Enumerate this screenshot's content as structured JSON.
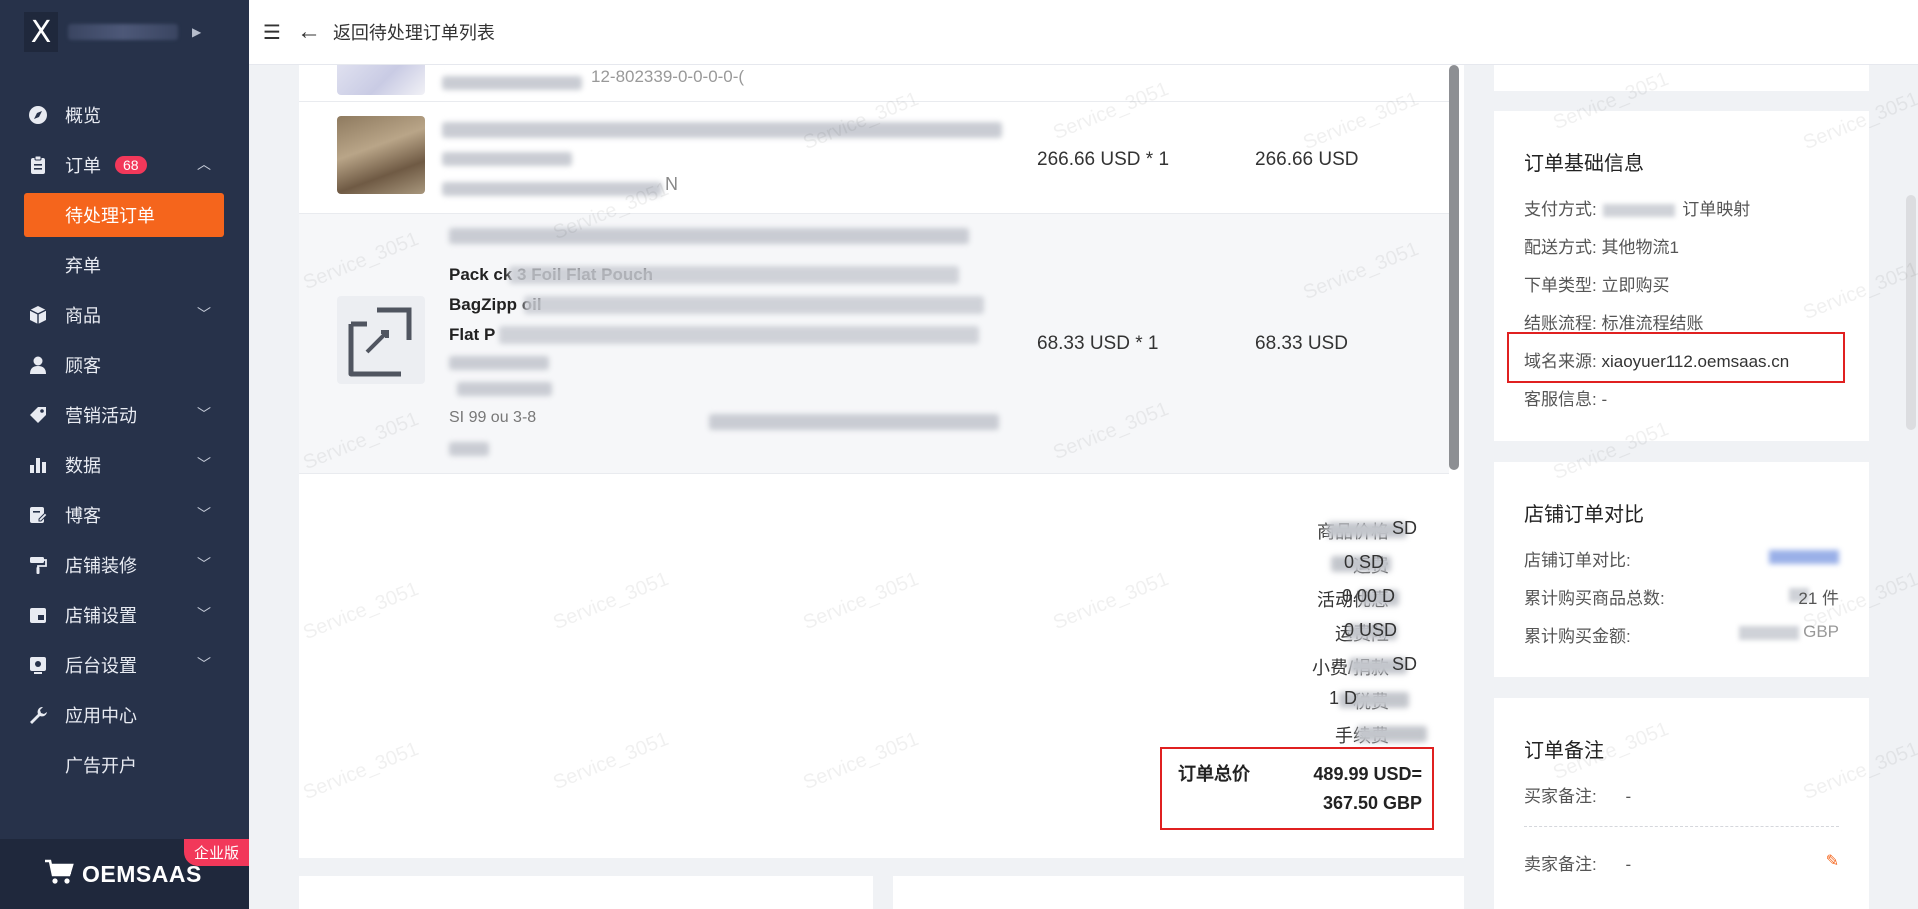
{
  "app": {
    "brand_letter": "X",
    "footer_logo": "OEMSAAS",
    "enterprise_tag": "企业版"
  },
  "sidebar": {
    "items": [
      {
        "label": "概览",
        "icon": "compass-icon"
      },
      {
        "label": "订单",
        "icon": "clipboard-icon",
        "badge": "68"
      },
      {
        "label": "待处理订单"
      },
      {
        "label": "弃单"
      },
      {
        "label": "商品",
        "icon": "box-icon"
      },
      {
        "label": "顾客",
        "icon": "user-icon"
      },
      {
        "label": "营销活动",
        "icon": "tag-icon"
      },
      {
        "label": "数据",
        "icon": "bar-chart-icon"
      },
      {
        "label": "博客",
        "icon": "edit-doc-icon"
      },
      {
        "label": "店铺装修",
        "icon": "paint-roller-icon"
      },
      {
        "label": "店铺设置",
        "icon": "store-icon"
      },
      {
        "label": "后台设置",
        "icon": "settings-icon"
      },
      {
        "label": "应用中心",
        "icon": "wrench-icon"
      },
      {
        "label": "广告开户"
      }
    ]
  },
  "topbar": {
    "back_label": "返回待处理订单列表"
  },
  "products": [
    {
      "sku_tail": "12-802339-0-0-0-0-(",
      "unit": "",
      "subtotal": ""
    },
    {
      "sku_tail": "N",
      "unit": "266.66 USD * 1",
      "subtotal": "266.66 USD"
    },
    {
      "title_lines": [
        "Pack          ck 3                    Foil Flat Pouch",
        "BagZipp                                            oil",
        "Flat P"
      ],
      "sku_line": "SI          99          ou      3-8",
      "unit": "68.33 USD * 1",
      "subtotal": "68.33 USD"
    }
  ],
  "summary": {
    "rows": [
      {
        "label": "商品价格",
        "value": "SD"
      },
      {
        "label": "运费",
        "value": "0      SD"
      },
      {
        "label": "活动优惠",
        "value": "0.00     D"
      },
      {
        "label": "运费险",
        "value": "0     USD"
      },
      {
        "label": "小费/捐款",
        "value": "SD"
      },
      {
        "label": "税费",
        "value": "1          D"
      },
      {
        "label": "手续费",
        "value": ""
      }
    ],
    "total_label": "订单总价",
    "total_usd": "489.99 USD=",
    "total_gbp": "367.50 GBP"
  },
  "order_info": {
    "title": "订单基础信息",
    "rows": [
      {
        "label": "支付方式:",
        "value": "订单映射"
      },
      {
        "label": "配送方式:",
        "value": "其他物流1"
      },
      {
        "label": "下单类型:",
        "value": "立即购买"
      },
      {
        "label": "结账流程:",
        "value": "标准流程结账"
      },
      {
        "label": "域名来源:",
        "value": "xiaoyuer112.oemsaas.cn"
      },
      {
        "label": "客服信息:",
        "value": "-"
      }
    ]
  },
  "store_compare": {
    "title": "店铺订单对比",
    "rows": [
      {
        "label": "店铺订单对比:",
        "value": ""
      },
      {
        "label": "累计购买商品总数:",
        "value": "21 件"
      },
      {
        "label": "累计购买金额:",
        "value": "GBP"
      }
    ]
  },
  "order_notes": {
    "title": "订单备注",
    "buyer_label": "买家备注:",
    "buyer_value": "-",
    "seller_label": "卖家备注:",
    "seller_value": "-"
  },
  "colors": {
    "sidebar_bg": "#27324a",
    "accent": "#f5651c",
    "badge": "#f2385a",
    "highlight_border": "#e02020"
  },
  "watermark_text": "Service_3051"
}
